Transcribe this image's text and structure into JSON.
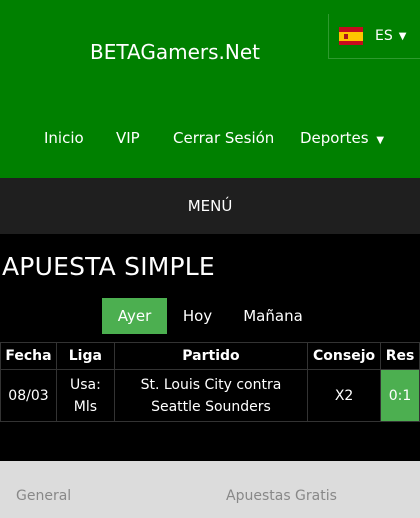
{
  "header": {
    "brand": "BETAGamers.Net",
    "language": "ES",
    "nav": [
      "Inicio",
      "VIP",
      "Cerrar Sesión",
      "Deportes"
    ]
  },
  "menu": {
    "label": "MENÚ"
  },
  "main": {
    "title": "APUESTA SIMPLE",
    "tabs": [
      "Ayer",
      "Hoy",
      "Mañana"
    ],
    "active_tab": "Ayer",
    "columns": [
      "Fecha",
      "Liga",
      "Partido",
      "Consejo",
      "Res"
    ],
    "rows": [
      {
        "fecha": "08/03",
        "liga": "Usa: Mls",
        "partido": "St. Louis City contra Seattle Sounders",
        "consejo": "X2",
        "res": "0:1"
      }
    ]
  },
  "footer": {
    "links": [
      "General",
      "Apuestas Gratis"
    ]
  },
  "colors": {
    "header_green": "#008000",
    "active_green": "#4caf50",
    "menu_bar": "#1f1f1f"
  }
}
